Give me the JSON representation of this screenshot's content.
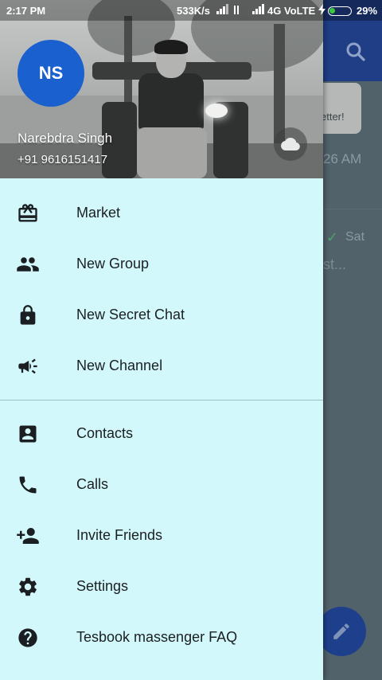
{
  "status_bar": {
    "time": "2:17 PM",
    "speed": "533K/s",
    "network": "4G VoLTE",
    "battery_pct": "29%",
    "battery_level": 0.29
  },
  "background_app": {
    "bubble_text": "etter!",
    "time_text": "26 AM",
    "check_mark": "✓",
    "day_text": "Sat",
    "preview_text": "st..."
  },
  "drawer": {
    "header": {
      "avatar_initials": "NS",
      "name": "Narebdra Singh",
      "phone": "+91 9616151417",
      "avatar_color": "#1a60cf"
    },
    "menu_group_1": [
      {
        "label": "Market",
        "icon": "gift-icon"
      },
      {
        "label": "New Group",
        "icon": "group-icon"
      },
      {
        "label": "New Secret Chat",
        "icon": "lock-icon"
      },
      {
        "label": "New Channel",
        "icon": "megaphone-icon"
      }
    ],
    "menu_group_2": [
      {
        "label": "Contacts",
        "icon": "contact-card-icon"
      },
      {
        "label": "Calls",
        "icon": "phone-icon"
      },
      {
        "label": "Invite Friends",
        "icon": "add-person-icon"
      },
      {
        "label": "Settings",
        "icon": "gear-icon"
      },
      {
        "label": "Tesbook massenger FAQ",
        "icon": "help-icon"
      }
    ]
  },
  "colors": {
    "drawer_bg": "#d2f8fc",
    "toolbar": "#1f3e86",
    "fab": "#1e3f8c"
  }
}
